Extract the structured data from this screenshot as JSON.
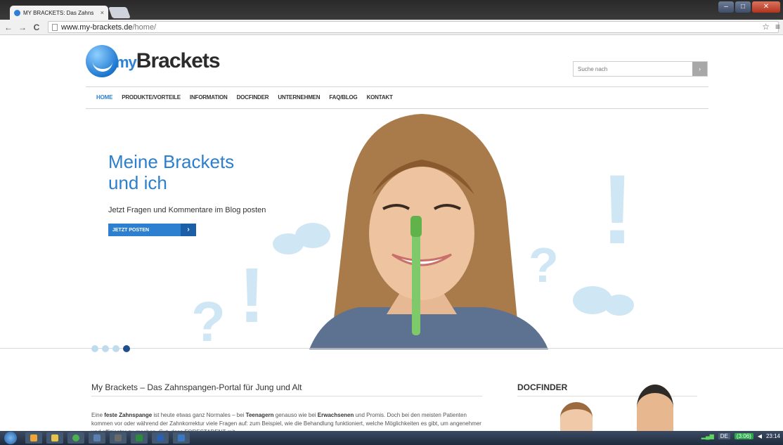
{
  "browser": {
    "tab_title": "MY BRACKETS: Das Zahns",
    "tab_close": "×",
    "url_host": "www.my-brackets.de",
    "url_path": "/home/",
    "back": "←",
    "forward": "→",
    "reload": "C",
    "star": "☆",
    "menu": "≡",
    "win_min": "–",
    "win_max": "□",
    "win_close": "✕"
  },
  "site": {
    "logo_my": "my",
    "logo_brand": "Brackets",
    "search_placeholder": "Suche nach",
    "search_go": "›"
  },
  "nav": {
    "items": [
      "HOME",
      "PRODUKTE/VORTEILE",
      "INFORMATION",
      "DOCFINDER",
      "UNTERNEHMEN",
      "FAQ/BLOG",
      "KONTAKT"
    ]
  },
  "hero": {
    "title_line1": "Meine Brackets",
    "title_line2": "und ich",
    "subtitle": "Jetzt Fragen und Kommentare im Blog posten",
    "button": "JETZT POSTEN",
    "button_arrow": "›",
    "slide_count": 4,
    "active_slide": 4
  },
  "article": {
    "title": "My Brackets – Das Zahnspangen-Portal für Jung und Alt",
    "text_1": "Eine ",
    "bold_1": "feste Zahnspange",
    "text_2": " ist heute etwas ganz Normales – bei ",
    "bold_2": "Teenagern",
    "text_3": " genauso wie bei ",
    "bold_3": "Erwachsenen",
    "text_4": " und Promis. Doch bei den meisten Patienten kommen vor oder während der Zahnkorrektur viele Fragen auf: zum Beispiel, wie die Behandlung",
    "text_5": "funktioniert, welche Möglichkeiten es gibt, um angenehmer und effizienter zu machen. Gut, dass FORESTADENT mit"
  },
  "docfinder": {
    "title": "DOCFINDER"
  },
  "taskbar": {
    "lang": "DE",
    "battery": "(3:06)",
    "time": "23:14"
  },
  "colors": {
    "accent": "#2c83d5",
    "deco": "#cfe6f4"
  }
}
